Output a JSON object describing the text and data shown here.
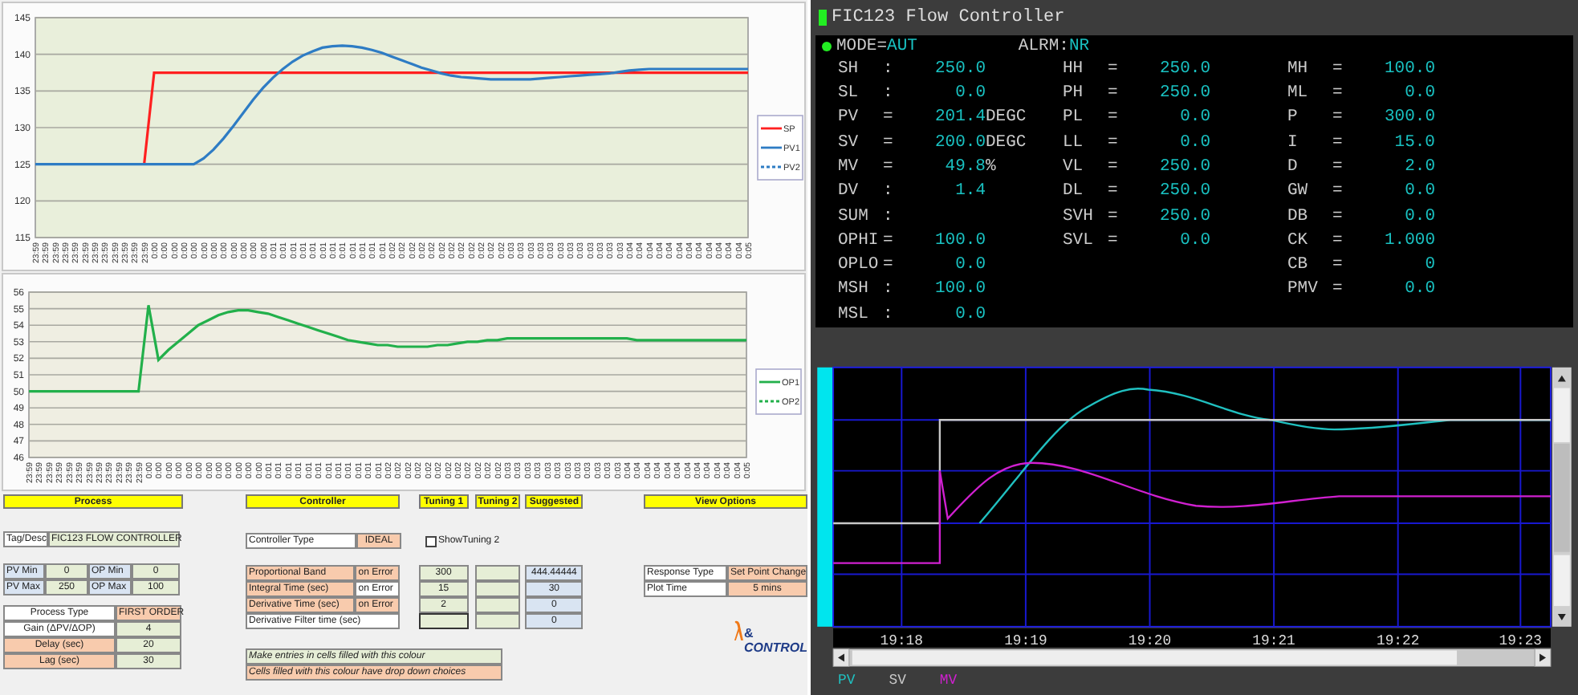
{
  "pv_chart": {
    "chart_data": {
      "type": "line",
      "x": [
        "23:59",
        "23:59",
        "23:59",
        "23:59",
        "23:59",
        "23:59",
        "23:59",
        "23:59",
        "23:59",
        "23:59",
        "23:59",
        "23:59",
        "0:00",
        "0:00",
        "0:00",
        "0:00",
        "0:00",
        "0:00",
        "0:00",
        "0:00",
        "0:00",
        "0:00",
        "0:00",
        "0:00",
        "0:01",
        "0:01",
        "0:01",
        "0:01",
        "0:01",
        "0:01",
        "0:01",
        "0:01",
        "0:01",
        "0:01",
        "0:01",
        "0:01",
        "0:02",
        "0:02",
        "0:02",
        "0:02",
        "0:02",
        "0:02",
        "0:02",
        "0:02",
        "0:02",
        "0:02",
        "0:02",
        "0:02",
        "0:03",
        "0:03",
        "0:03",
        "0:03",
        "0:03",
        "0:03",
        "0:03",
        "0:03",
        "0:03",
        "0:03",
        "0:03",
        "0:03",
        "0:04",
        "0:04",
        "0:04",
        "0:04",
        "0:04",
        "0:04",
        "0:04",
        "0:04",
        "0:04",
        "0:04",
        "0:04",
        "0:04",
        "0:05"
      ],
      "ylim": [
        115,
        145
      ],
      "yticks": [
        115,
        120,
        125,
        130,
        135,
        140,
        145
      ],
      "grid": true,
      "legend": true,
      "series": [
        {
          "name": "SP",
          "color": "#ff2020",
          "line_style": "solid",
          "values": [
            null,
            null,
            null,
            null,
            null,
            null,
            null,
            null,
            null,
            null,
            null,
            125,
            137.5,
            137.5,
            137.5,
            137.5,
            137.5,
            137.5,
            137.5,
            137.5,
            137.5,
            137.5,
            137.5,
            137.5,
            137.5,
            137.5,
            137.5,
            137.5,
            137.5,
            137.5,
            137.5,
            137.5,
            137.5,
            137.5,
            137.5,
            137.5,
            137.5,
            137.5,
            137.5,
            137.5,
            137.5,
            137.5,
            137.5,
            137.5,
            137.5,
            137.5,
            137.5,
            137.5,
            137.5,
            137.5,
            137.5,
            137.5,
            137.5,
            137.5,
            137.5,
            137.5,
            137.5,
            137.5,
            137.5,
            137.5,
            137.5,
            137.5,
            137.5,
            137.5,
            137.5,
            137.5,
            137.5,
            137.5,
            137.5,
            137.5,
            137.5,
            137.5,
            137.5
          ]
        },
        {
          "name": "PV1",
          "color": "#2e7cc4",
          "line_style": "solid",
          "values": [
            125,
            125,
            125,
            125,
            125,
            125,
            125,
            125,
            125,
            125,
            125,
            125,
            125,
            125,
            125,
            125,
            125,
            125.8,
            127,
            128.5,
            130.2,
            132,
            133.8,
            135.4,
            136.8,
            138,
            139,
            139.8,
            140.4,
            140.9,
            141.1,
            141.2,
            141.1,
            140.9,
            140.6,
            140.2,
            139.7,
            139.2,
            138.7,
            138.2,
            137.8,
            137.4,
            137.1,
            136.9,
            136.8,
            136.7,
            136.6,
            136.6,
            136.6,
            136.6,
            136.6,
            136.7,
            136.8,
            136.9,
            137,
            137.1,
            137.2,
            137.3,
            137.4,
            137.6,
            137.8,
            137.9,
            138,
            138,
            138,
            138,
            138,
            138,
            138,
            138,
            138,
            138,
            138
          ]
        },
        {
          "name": "PV2",
          "color": "#2e7cc4",
          "line_style": "dashed",
          "values": [
            null,
            null,
            null,
            null,
            null,
            null,
            null,
            null,
            null,
            null,
            null,
            null,
            null,
            null,
            null,
            null,
            null,
            null,
            null,
            null,
            null,
            null,
            null,
            null,
            null,
            null,
            null,
            null,
            null,
            null,
            null,
            null,
            null,
            null,
            null,
            null,
            null,
            null,
            null,
            null,
            null,
            null,
            null,
            null,
            null,
            null,
            null,
            null,
            null,
            null,
            null,
            null,
            null,
            null,
            null,
            null,
            null,
            null,
            null,
            null,
            null,
            null,
            null,
            null,
            null,
            null,
            null,
            null,
            null,
            null,
            null,
            null,
            null
          ]
        }
      ]
    }
  },
  "op_chart": {
    "chart_data": {
      "type": "line",
      "x": [
        "23:59",
        "23:59",
        "23:59",
        "23:59",
        "23:59",
        "23:59",
        "23:59",
        "23:59",
        "23:59",
        "23:59",
        "23:59",
        "23:59",
        "0:00",
        "0:00",
        "0:00",
        "0:00",
        "0:00",
        "0:00",
        "0:00",
        "0:00",
        "0:00",
        "0:00",
        "0:00",
        "0:00",
        "0:01",
        "0:01",
        "0:01",
        "0:01",
        "0:01",
        "0:01",
        "0:01",
        "0:01",
        "0:01",
        "0:01",
        "0:01",
        "0:01",
        "0:02",
        "0:02",
        "0:02",
        "0:02",
        "0:02",
        "0:02",
        "0:02",
        "0:02",
        "0:02",
        "0:02",
        "0:02",
        "0:02",
        "0:03",
        "0:03",
        "0:03",
        "0:03",
        "0:03",
        "0:03",
        "0:03",
        "0:03",
        "0:03",
        "0:03",
        "0:03",
        "0:03",
        "0:04",
        "0:04",
        "0:04",
        "0:04",
        "0:04",
        "0:04",
        "0:04",
        "0:04",
        "0:04",
        "0:04",
        "0:04",
        "0:04",
        "0:05"
      ],
      "ylim": [
        46,
        56
      ],
      "yticks": [
        46,
        47,
        48,
        49,
        50,
        51,
        52,
        53,
        54,
        55,
        56
      ],
      "grid": true,
      "legend": true,
      "series": [
        {
          "name": "OP1",
          "color": "#22b04b",
          "line_style": "solid",
          "values": [
            50,
            50,
            50,
            50,
            50,
            50,
            50,
            50,
            50,
            50,
            50,
            50,
            55.2,
            51.9,
            52.5,
            53,
            53.5,
            54,
            54.3,
            54.6,
            54.8,
            54.9,
            54.9,
            54.8,
            54.7,
            54.5,
            54.3,
            54.1,
            53.9,
            53.7,
            53.5,
            53.3,
            53.1,
            53,
            52.9,
            52.8,
            52.8,
            52.7,
            52.7,
            52.7,
            52.7,
            52.8,
            52.8,
            52.9,
            53,
            53,
            53.1,
            53.1,
            53.2,
            53.2,
            53.2,
            53.2,
            53.2,
            53.2,
            53.2,
            53.2,
            53.2,
            53.2,
            53.2,
            53.2,
            53.2,
            53.1,
            53.1,
            53.1,
            53.1,
            53.1,
            53.1,
            53.1,
            53.1,
            53.1,
            53.1,
            53.1,
            53.1
          ]
        },
        {
          "name": "OP2",
          "color": "#22b04b",
          "line_style": "dashed",
          "values": [
            null,
            null,
            null,
            null,
            null,
            null,
            null,
            null,
            null,
            null,
            null,
            null,
            null,
            null,
            null,
            null,
            null,
            null,
            null,
            null,
            null,
            null,
            null,
            null,
            null,
            null,
            null,
            null,
            null,
            null,
            null,
            null,
            null,
            null,
            null,
            null,
            null,
            null,
            null,
            null,
            null,
            null,
            null,
            null,
            null,
            null,
            null,
            null,
            null,
            null,
            null,
            null,
            null,
            null,
            null,
            null,
            null,
            null,
            null,
            null,
            null,
            null,
            null,
            null,
            null,
            null,
            null,
            null,
            null,
            null,
            null,
            null,
            null
          ]
        }
      ]
    }
  },
  "sheet": {
    "headers": {
      "process": "Process",
      "controller": "Controller",
      "tuning_1": "Tuning 1",
      "tuning_2": "Tuning 2",
      "suggested": "Suggested",
      "view_options": "View Options"
    },
    "tag": {
      "label": "Tag/Desc",
      "value": "FIC123 FLOW CONTROLLER"
    },
    "ranges": [
      {
        "label": "PV Min",
        "value": "0"
      },
      {
        "label": "OP Min",
        "value": "0"
      },
      {
        "label": "PV Max",
        "value": "250"
      },
      {
        "label": "OP Max",
        "value": "100"
      }
    ],
    "process": [
      {
        "label": "Process Type",
        "value": "FIRST ORDER"
      },
      {
        "label": "Gain (ΔPV/ΔOP)",
        "value": "4"
      },
      {
        "label": "Delay (sec)",
        "value": "20"
      },
      {
        "label": "Lag (sec)",
        "value": "30"
      }
    ],
    "controller_type": {
      "label": "Controller Type",
      "value": "IDEAL"
    },
    "show_tuning_2": {
      "label": "ShowTuning 2",
      "checked": false
    },
    "tuning": [
      {
        "label": "Proportional Band",
        "mode": "on Error",
        "tuning_1": "300",
        "suggested": "444.44444"
      },
      {
        "label": "Integral Time (sec)",
        "mode": "on Error",
        "tuning_1": "15",
        "suggested": "30"
      },
      {
        "label": "Derivative Time (sec)",
        "mode": "on Error",
        "tuning_1": "2",
        "suggested": "0"
      },
      {
        "label": "Derivative Filter time (sec)",
        "suggested": "0"
      }
    ],
    "notes": [
      "Make entries in cells filled with this colour",
      "Cells filled with this colour have drop down choices"
    ],
    "view_options": [
      {
        "label": "Response Type",
        "value": "Set Point Change"
      },
      {
        "label": "Plot Time",
        "value": "5 mins"
      }
    ],
    "logo": {
      "ampersand": "&",
      "word": "CONTROL"
    }
  },
  "faceplate": {
    "title": "FIC123 Flow Controller",
    "mode_label": "MODE=",
    "mode": "AUT",
    "alarm_label": "ALRM:",
    "alarm": "NR",
    "columns": [
      [
        {
          "label": "SH",
          "sep": ":",
          "value": "250.0"
        },
        {
          "label": "SL",
          "sep": ":",
          "value": "0.0"
        },
        {
          "label": "PV",
          "sep": "=",
          "value": "201.4",
          "unit": "DEGC"
        },
        {
          "label": "SV",
          "sep": "=",
          "value": "200.0",
          "unit": "DEGC"
        },
        {
          "label": "MV",
          "sep": "=",
          "value": "49.8",
          "unit": "%"
        },
        {
          "label": "DV",
          "sep": ":",
          "value": "1.4"
        },
        {
          "label": "SUM",
          "sep": ":"
        },
        {
          "label": "OPHI",
          "sep": "=",
          "value": "100.0"
        },
        {
          "label": "OPLO",
          "sep": "=",
          "value": "0.0"
        },
        {
          "label": "MSH",
          "sep": ":",
          "value": "100.0"
        },
        {
          "label": "MSL",
          "sep": ":",
          "value": "0.0"
        }
      ],
      [
        {
          "label": "HH",
          "sep": "=",
          "value": "250.0"
        },
        {
          "label": "PH",
          "sep": "=",
          "value": "250.0"
        },
        {
          "label": "PL",
          "sep": "=",
          "value": "0.0"
        },
        {
          "label": "LL",
          "sep": "=",
          "value": "0.0"
        },
        {
          "label": "VL",
          "sep": "=",
          "value": "250.0"
        },
        {
          "label": "DL",
          "sep": "=",
          "value": "250.0"
        },
        {
          "label": "SVH",
          "sep": "=",
          "value": "250.0"
        },
        {
          "label": "SVL",
          "sep": "=",
          "value": "0.0"
        }
      ],
      [
        {
          "label": "MH",
          "sep": "=",
          "value": "100.0"
        },
        {
          "label": "ML",
          "sep": "=",
          "value": "0.0"
        },
        {
          "label": "P",
          "sep": "=",
          "value": "300.0"
        },
        {
          "label": "I",
          "sep": "=",
          "value": "15.0"
        },
        {
          "label": "D",
          "sep": "=",
          "value": "2.0"
        },
        {
          "label": "GW",
          "sep": "=",
          "value": "0.0"
        },
        {
          "label": "DB",
          "sep": "=",
          "value": "0.0"
        },
        {
          "label": "CK",
          "sep": "=",
          "value": "1.000"
        },
        {
          "label": "CB",
          "sep": "=",
          "value": "0"
        },
        {
          "label": "PMV",
          "sep": "=",
          "value": "0.0"
        }
      ]
    ]
  },
  "trend": {
    "time_labels": [
      "19:18",
      "19:19",
      "19:20",
      "19:21",
      "19:22",
      "19:23"
    ],
    "legend": [
      {
        "label": "PV",
        "color": "#20c0c0"
      },
      {
        "label": "SV",
        "color": "#c8c8c8"
      },
      {
        "label": "MV",
        "color": "#d020d0"
      }
    ]
  }
}
